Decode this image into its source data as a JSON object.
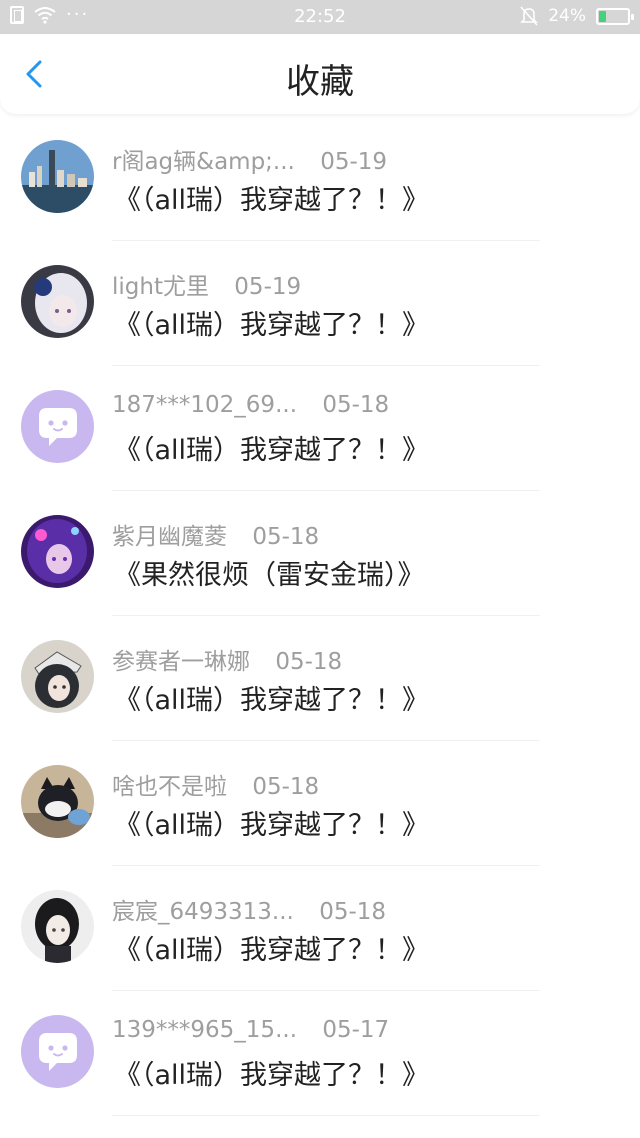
{
  "statusbar": {
    "time": "22:52",
    "battery": "24%",
    "battery_level": 0.24,
    "battery_color": "#43d17b",
    "dots": "···"
  },
  "navbar": {
    "title": "收藏",
    "back_icon": "chevron-left-icon",
    "accent": "#2196f3"
  },
  "items": [
    {
      "name": "r阁ag辆&amp;...",
      "date": "05-19",
      "title": "《（all瑞）我穿越了？！》",
      "avatar": "city-photo"
    },
    {
      "name": "light尤里",
      "date": "05-19",
      "title": "《（all瑞）我穿越了？！》",
      "avatar": "anime-white-hair"
    },
    {
      "name": "187***102_69...",
      "date": "05-18",
      "title": "《（all瑞）我穿越了？！》",
      "avatar": "default-chat"
    },
    {
      "name": "紫月幽魔菱",
      "date": "05-18",
      "title": "《果然很烦（雷安金瑞）》",
      "avatar": "anime-purple"
    },
    {
      "name": "参赛者一琳娜",
      "date": "05-18",
      "title": "《（all瑞）我穿越了？！》",
      "avatar": "anime-dark-hat"
    },
    {
      "name": "啥也不是啦",
      "date": "05-18",
      "title": "《（all瑞）我穿越了？！》",
      "avatar": "cat-figure"
    },
    {
      "name": "宸宸_6493313...",
      "date": "05-18",
      "title": "《（all瑞）我穿越了？！》",
      "avatar": "anime-black-hair"
    },
    {
      "name": "139***965_15...",
      "date": "05-17",
      "title": "《（all瑞）我穿越了？！》",
      "avatar": "default-chat"
    }
  ]
}
